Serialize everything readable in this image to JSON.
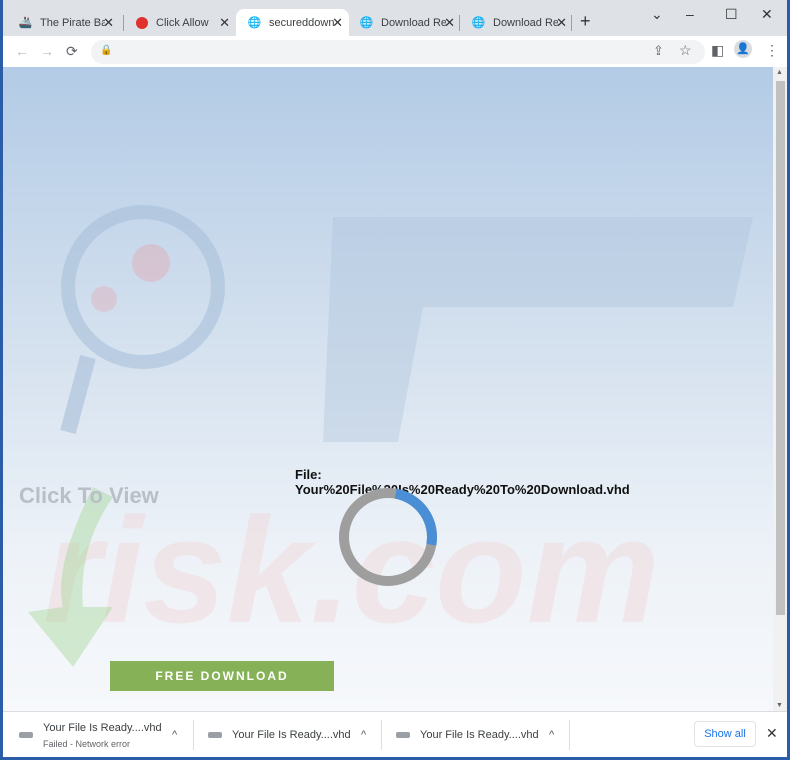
{
  "tabs": [
    {
      "title": "The Pirate Bay",
      "icon": "pirate-ship-icon"
    },
    {
      "title": "Click Allow",
      "icon": "red-circle-icon"
    },
    {
      "title": "secureddownload",
      "icon": "globe-icon",
      "active": true
    },
    {
      "title": "Download Ready",
      "icon": "globe-icon"
    },
    {
      "title": "Download Ready",
      "icon": "globe-icon"
    }
  ],
  "page": {
    "click_to_view": "Click To View",
    "file_label": "File:",
    "file_name": "Your%20File%20Is%20Ready%20To%20Download.vhd",
    "download_button": "FREE DOWNLOAD",
    "spinner_progress": 0.25,
    "colors": {
      "button": "#86b156",
      "spinner_track": "#9e9e9e",
      "spinner_arc": "#4a8fd6"
    },
    "watermark": "PCrisk.com"
  },
  "downloads": {
    "items": [
      {
        "name": "Your File Is Ready....vhd",
        "status": "Failed - Network error"
      },
      {
        "name": "Your File Is Ready....vhd"
      },
      {
        "name": "Your File Is Ready....vhd"
      }
    ],
    "show_all": "Show all"
  }
}
